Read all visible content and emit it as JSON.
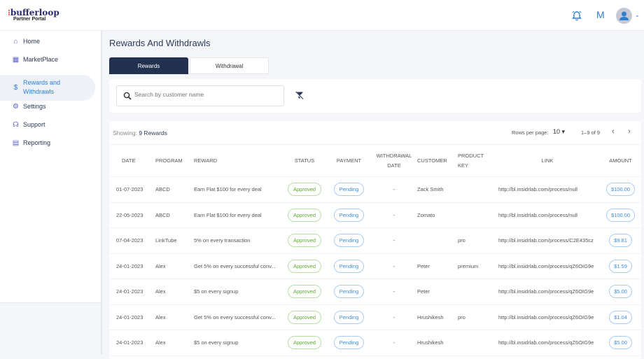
{
  "brand": {
    "name": "bufferloop",
    "subtitle": "Partner Portal"
  },
  "header": {
    "user_initial": "M"
  },
  "sidebar": {
    "items": [
      {
        "label": "Home",
        "icon": "home-icon"
      },
      {
        "label": "MarketPlace",
        "icon": "store-icon"
      },
      {
        "label": "Rewards and",
        "label2": "Withdrawls",
        "icon": "dollar-icon"
      },
      {
        "label": "Settings",
        "icon": "gear-icon"
      },
      {
        "label": "Support",
        "icon": "headset-icon"
      },
      {
        "label": "Reporting",
        "icon": "clipboard-icon"
      }
    ]
  },
  "page": {
    "title": "Rewards And Withdrawls",
    "tabs": [
      "Rewards",
      "Withdrawal"
    ],
    "search_placeholder": "Search by customer name"
  },
  "table": {
    "showing_label": "Showing:",
    "showing_value": "9 Rewards",
    "rows_per_page_label": "Rows per page:",
    "rows_per_page": "10",
    "range": "1–9 of 9",
    "headers": [
      "DATE",
      "PROGRAM",
      "REWARD",
      "STATUS",
      "PAYMENT",
      "WITHDRAWAL",
      "DATE",
      "CUSTOMER",
      "PRODUCT",
      "KEY",
      "LINK",
      "AMOUNT"
    ],
    "rows": [
      {
        "date": "01-07-2023",
        "program": "ABCD",
        "reward": "Earn Flat $100 for every deal",
        "status": "Approved",
        "payment": "Pending",
        "wdate": "-",
        "customer": "Zack Smith",
        "key": "",
        "link": "http://bl.insidrlab.com/process/null",
        "amount": "$100.00"
      },
      {
        "date": "22-05-2023",
        "program": "ABCD",
        "reward": "Earn Flat $100 for every deal",
        "status": "Approved",
        "payment": "Pending",
        "wdate": "-",
        "customer": "Zomato",
        "key": "",
        "link": "http://bl.insidrlab.com/process/null",
        "amount": "$100.00"
      },
      {
        "date": "07-04-2023",
        "program": "LinkTube",
        "reward": "5% on every transaction",
        "status": "Approved",
        "payment": "Pending",
        "wdate": "-",
        "customer": "",
        "key": "pro",
        "link": "http://bl.insidrlab.com/process/C2E435cz",
        "amount": "$9.81"
      },
      {
        "date": "24-01-2023",
        "program": "Alex",
        "reward": "Get 5% on every successful conv...",
        "status": "Approved",
        "payment": "Pending",
        "wdate": "-",
        "customer": "Peter",
        "key": "premium",
        "link": "http://bl.insidrlab.com/process/qZ6OIG9e",
        "amount": "$1.59"
      },
      {
        "date": "24-01-2023",
        "program": "Alex",
        "reward": "$5 on every signup",
        "status": "Approved",
        "payment": "Pending",
        "wdate": "-",
        "customer": "Peter",
        "key": "",
        "link": "http://bl.insidrlab.com/process/qZ6OIG9e",
        "amount": "$5.00"
      },
      {
        "date": "24-01-2023",
        "program": "Alex",
        "reward": "Get 5% on every successful conv...",
        "status": "Approved",
        "payment": "Pending",
        "wdate": "-",
        "customer": "Hrushikesh",
        "key": "pro",
        "link": "http://bl.insidrlab.com/process/qZ6OIG9e",
        "amount": "$1.04"
      },
      {
        "date": "24-01-2023",
        "program": "Alex",
        "reward": "$5 on every signup",
        "status": "Approved",
        "payment": "Pending",
        "wdate": "-",
        "customer": "Hrushikesh",
        "key": "",
        "link": "http://bl.insidrlab.com/process/qZ6OIG9e",
        "amount": "$5.00"
      }
    ]
  }
}
